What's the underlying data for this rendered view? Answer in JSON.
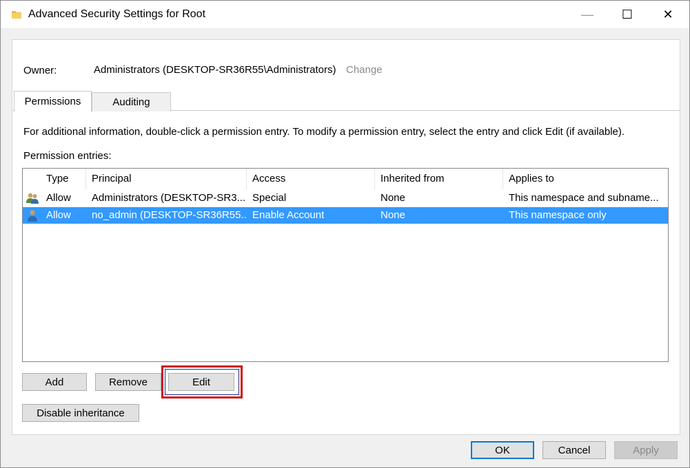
{
  "window": {
    "title": "Advanced Security Settings for Root",
    "min_glyph": "—",
    "max_glyph": "☐",
    "close_glyph": "✕"
  },
  "owner": {
    "label": "Owner:",
    "value": "Administrators (DESKTOP-SR36R55\\Administrators)",
    "change_link": "Change"
  },
  "tabs": [
    {
      "label": "Permissions",
      "active": true
    },
    {
      "label": "Auditing",
      "active": false
    }
  ],
  "info_text": "For additional information, double-click a permission entry. To modify a permission entry, select the entry and click Edit (if available).",
  "entries_label": "Permission entries:",
  "table": {
    "columns": [
      "Type",
      "Principal",
      "Access",
      "Inherited from",
      "Applies to"
    ],
    "rows": [
      {
        "icon": "group-users-icon",
        "type": "Allow",
        "principal": "Administrators (DESKTOP-SR3...",
        "access": "Special",
        "inherited": "None",
        "applies": "This namespace and subname...",
        "selected": false
      },
      {
        "icon": "user-icon",
        "type": "Allow",
        "principal": "no_admin (DESKTOP-SR36R55...",
        "access": "Enable Account",
        "inherited": "None",
        "applies": "This namespace only",
        "selected": true
      }
    ]
  },
  "buttons": {
    "add": "Add",
    "remove": "Remove",
    "edit": "Edit",
    "disable_inheritance": "Disable inheritance",
    "ok": "OK",
    "cancel": "Cancel",
    "apply": "Apply"
  },
  "colors": {
    "selection": "#3399ff",
    "highlight_border": "#cc1010",
    "ok_border": "#0078d7"
  }
}
